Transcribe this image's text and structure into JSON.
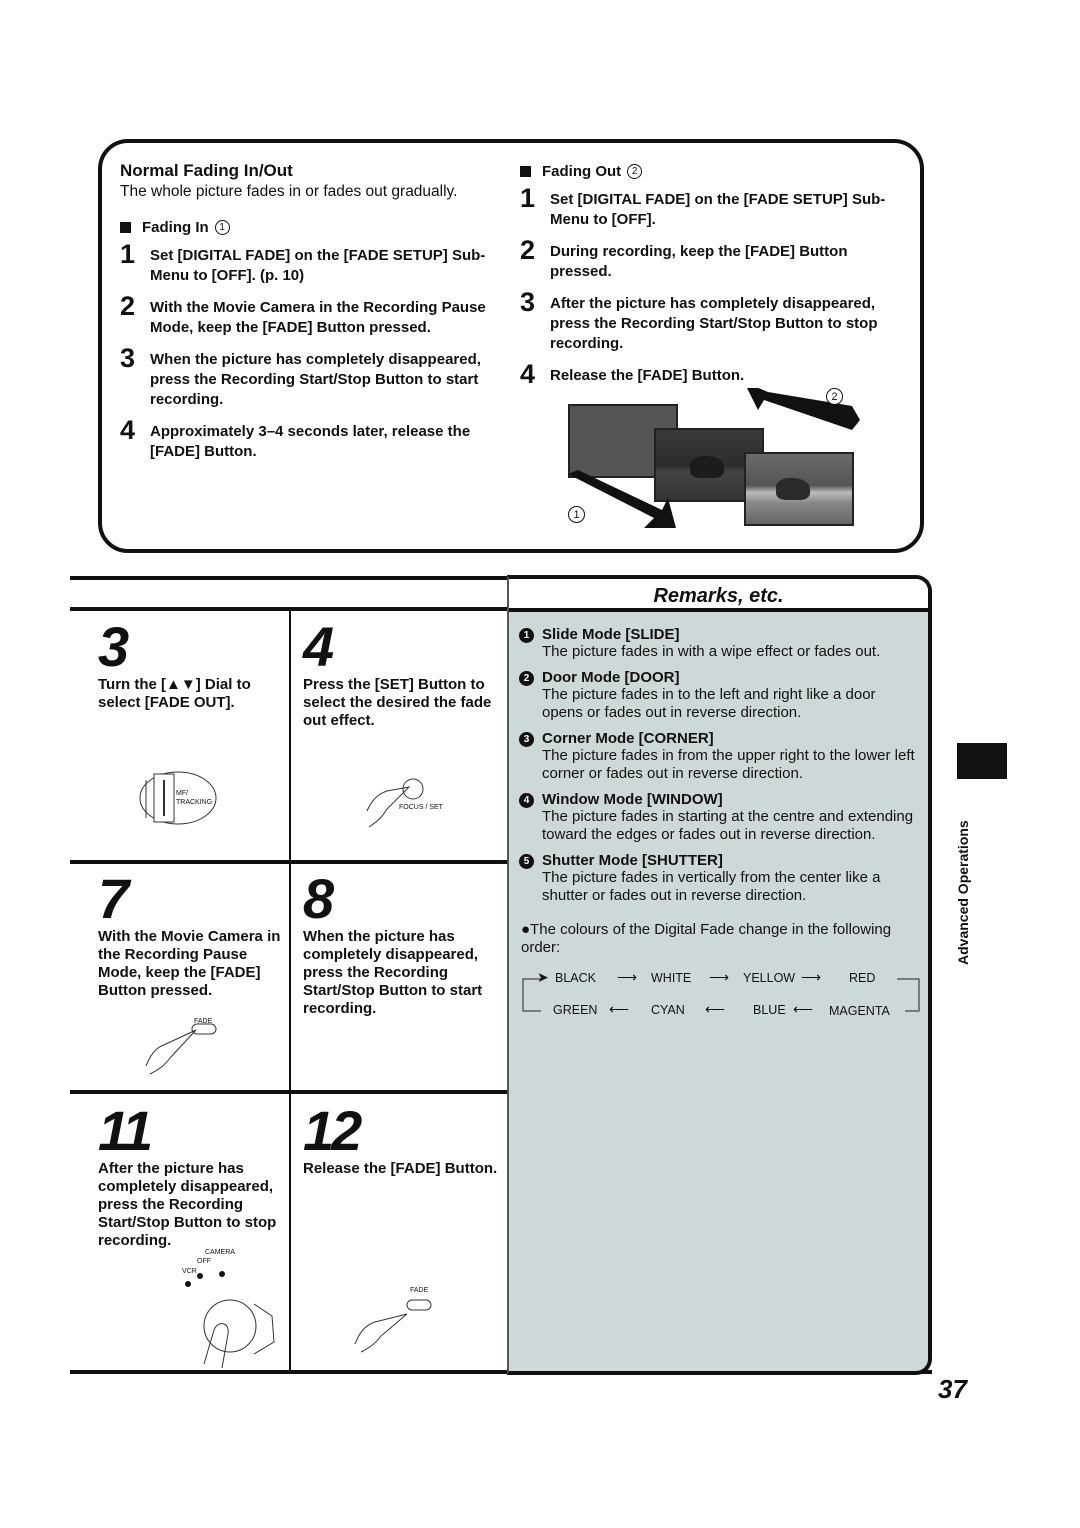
{
  "normal_fading": {
    "title": "Normal Fading In/Out",
    "description": "The whole picture fades in or fades out gradually.",
    "fading_in": {
      "heading": "Fading In",
      "marker": "1",
      "steps": [
        {
          "num": "1",
          "text": "Set [DIGITAL FADE] on the [FADE SETUP] Sub-Menu to [OFF]. (p. 10)"
        },
        {
          "num": "2",
          "text": "With the Movie Camera in the Recording Pause Mode, keep the [FADE] Button pressed."
        },
        {
          "num": "3",
          "text": "When the picture has completely disappeared, press the Recording Start/Stop Button to start recording."
        },
        {
          "num": "4",
          "text": "Approximately 3–4 seconds later, release the [FADE] Button."
        }
      ]
    },
    "fading_out": {
      "heading": "Fading Out",
      "marker": "2",
      "steps": [
        {
          "num": "1",
          "text": "Set [DIGITAL FADE] on the [FADE SETUP] Sub-Menu to [OFF]."
        },
        {
          "num": "2",
          "text": "During recording, keep the [FADE] Button pressed."
        },
        {
          "num": "3",
          "text": "After the picture has completely disappeared, press the Recording Start/Stop Button to stop recording."
        },
        {
          "num": "4",
          "text": "Release the [FADE] Button."
        }
      ]
    },
    "illustration": {
      "label_in": "1",
      "label_out": "2"
    }
  },
  "steps_grid": [
    {
      "num": "3",
      "text": "Turn the [▲▼] Dial to select [FADE OUT].",
      "illus_labels": [
        "MF/",
        "TRACKING"
      ]
    },
    {
      "num": "4",
      "text": "Press the [SET] Button to select the desired the fade out effect.",
      "illus_labels": [
        "FOCUS / SET"
      ]
    },
    {
      "num": "7",
      "text": "With the Movie Camera in the Recording Pause Mode, keep the [FADE] Button pressed.",
      "illus_labels": [
        "FADE"
      ]
    },
    {
      "num": "8",
      "text": "When the picture has completely disappeared, press the Recording Start/Stop Button to start recording.",
      "illus_labels": []
    },
    {
      "num": "11",
      "text": "After the picture has completely disappeared, press the Recording Start/Stop Button to stop recording.",
      "illus_labels": [
        "CAMERA",
        "OFF",
        "VCR"
      ]
    },
    {
      "num": "12",
      "text": "Release the [FADE] Button.",
      "illus_labels": [
        "FADE"
      ]
    }
  ],
  "remarks": {
    "title": "Remarks, etc.",
    "modes": [
      {
        "num": "1",
        "title": "Slide Mode [SLIDE]",
        "desc": "The picture fades in with a wipe effect or fades out."
      },
      {
        "num": "2",
        "title": "Door Mode [DOOR]",
        "desc": "The picture fades in to the left and right like a door opens or fades out in reverse direction."
      },
      {
        "num": "3",
        "title": "Corner Mode [CORNER]",
        "desc": "The picture fades in from the upper right to the lower left corner or fades out in reverse direction."
      },
      {
        "num": "4",
        "title": "Window Mode [WINDOW]",
        "desc": "The picture fades in starting at the centre and extending toward the edges or fades out in reverse direction."
      },
      {
        "num": "5",
        "title": "Shutter Mode [SHUTTER]",
        "desc": "The picture fades in vertically from the center like a shutter or fades out in reverse direction."
      }
    ],
    "note": "●The colours of the Digital Fade change in the following order:",
    "color_cycle": {
      "row1": [
        "BLACK",
        "WHITE",
        "YELLOW",
        "RED"
      ],
      "row2": [
        "GREEN",
        "CYAN",
        "BLUE",
        "MAGENTA"
      ]
    }
  },
  "side_label": "Advanced Operations",
  "page_number": "37",
  "colors": {
    "remarks_bg": "#cfd8d8",
    "ink": "#111111"
  }
}
